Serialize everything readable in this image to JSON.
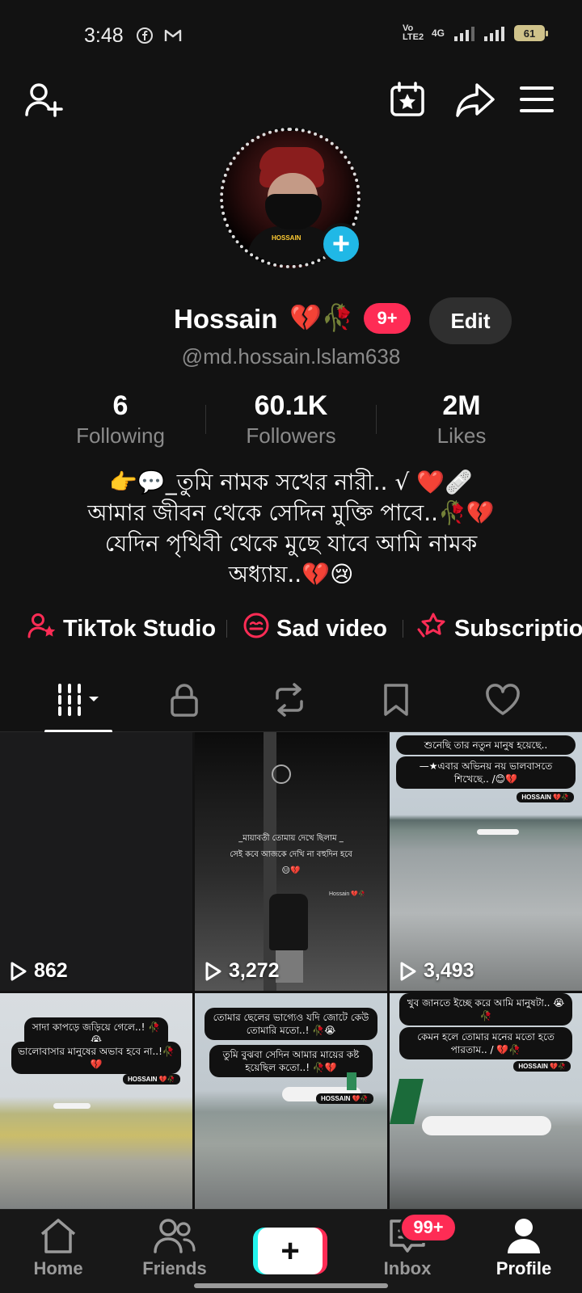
{
  "status_bar": {
    "time": "3:48",
    "network": "4G",
    "volte": "Vo LTE2",
    "battery": "61"
  },
  "profile": {
    "name": "Hossain",
    "name_emoji": "💔🥀",
    "badge": "9+",
    "edit_label": "Edit",
    "handle": "@md.hossain.lslam638",
    "avatar_tag": "HOSSAIN"
  },
  "stats": [
    {
      "value": "6",
      "label": "Following"
    },
    {
      "value": "60.1K",
      "label": "Followers"
    },
    {
      "value": "2M",
      "label": "Likes"
    }
  ],
  "bio": {
    "line1": "👉💬_তুমি নামক সখের নারী.. √ ❤️🩹",
    "line2": "আমার জীবন থেকে সেদিন মুক্তি পাবে..🥀💔",
    "line3": "যেদিন পৃথিবী থেকে মুছে যাবে আমি নামক",
    "line4": "অধ্যায়..💔😢"
  },
  "links": [
    {
      "label": "TikTok Studio",
      "icon": "user-star-icon"
    },
    {
      "label": "Sad video",
      "icon": "sad-face-icon"
    },
    {
      "label": "Subscriptio",
      "icon": "star-hand-icon"
    }
  ],
  "videos": [
    {
      "views": "862",
      "captions": []
    },
    {
      "views": "3,272",
      "captions": [
        "_মায়াবতী তোমায় দেখে ছিলাম _",
        "সেই কবে আজকে দেখি না বহুদিন হবে",
        "😑💔"
      ],
      "watermark": "Hossain 💔🥀"
    },
    {
      "views": "3,493",
      "captions": [
        "শুনেছি তার নতুন মানুষ হয়েছে..",
        "—★এবার অভিনয় নয় ভালবাসতে শিখেছে.. /😊💔"
      ],
      "watermark": "HOSSAIN 💔🥀"
    },
    {
      "views": "",
      "captions": [
        "সাদা কাপড়ে জড়িয়ে গেলে..! 🥀😭",
        "ভালোবাসার মানুষের অভাব হবে না..!🥀💔"
      ],
      "watermark": "HOSSAIN 💔🥀"
    },
    {
      "views": "",
      "captions": [
        "তোমার ছেলের ভাগ্যেও যদি জোটে কেউ তোমারি মতো..! 🥀😭",
        "তুমি বুঝবা সেদিন আমার মায়ের কষ্ট হয়েছিল কতো..! 🥀💔"
      ],
      "watermark": "HOSSAIN 💔🥀"
    },
    {
      "views": "",
      "captions": [
        "খুব জানতে ইচ্ছে করে আমি মানুষটা.. 😭🥀",
        "কেমন হলে তোমার মনের মতো হতে পারতাম.. / 💔🥀"
      ],
      "watermark": "HOSSAIN 💔🥀"
    }
  ],
  "nav": {
    "home": "Home",
    "friends": "Friends",
    "inbox": "Inbox",
    "inbox_badge": "99+",
    "profile": "Profile"
  },
  "colors": {
    "background": "#121212",
    "accent_red": "#fe2c55",
    "accent_cyan": "#25f4ee",
    "avatar_add": "#20b8e6"
  }
}
